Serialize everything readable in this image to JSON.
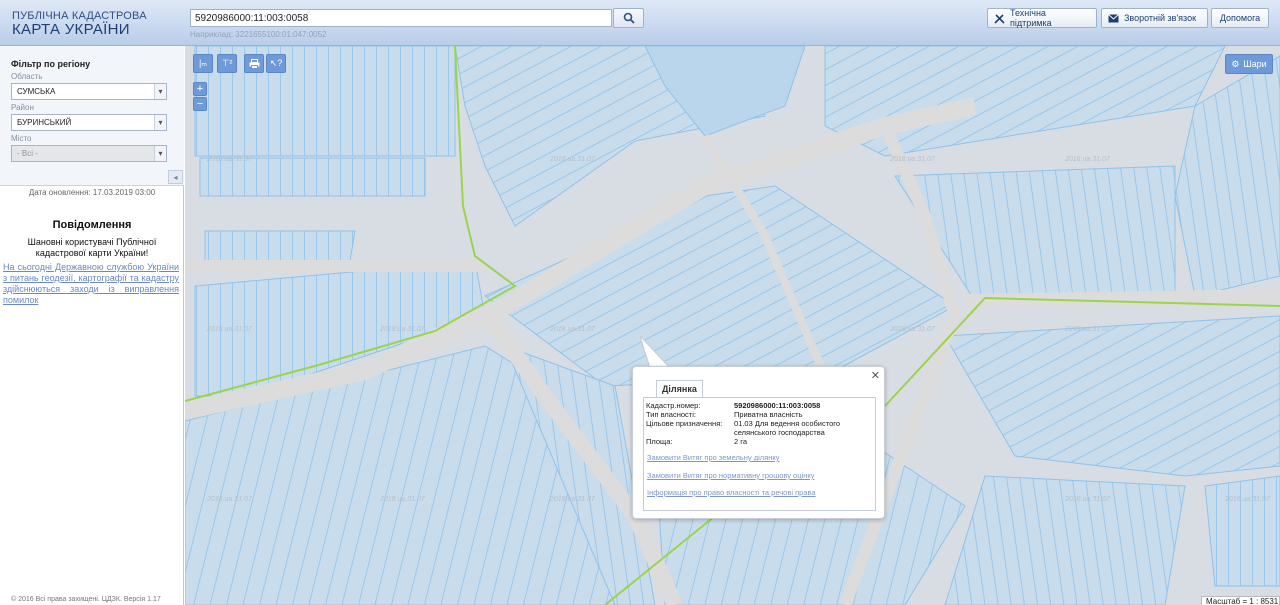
{
  "header": {
    "logo_top": "ПУБЛІЧНА КАДАСТРОВА",
    "logo_main": "КАРТА УКРАЇНИ",
    "search_value": "5920986000:11:003:0058",
    "search_hint": "Наприклад: 3221655100:01:047:0052",
    "buttons": {
      "support": "Технічна підтримка",
      "feedback": "Зворотній зв'язок",
      "help": "Допомога"
    }
  },
  "sidebar": {
    "filter_title": "Фільтр по регіону",
    "region_label": "Область",
    "region_value": "СУМСЬКА",
    "district_label": "Район",
    "district_value": "БУРИНСЬКИЙ",
    "city_label": "Місто",
    "city_value": "- Всі -",
    "update_date": "Дата оновлення: 17.03.2019 03:00",
    "notice_title": "Повідомлення",
    "notice_greeting": "Шановні користувачі Публічної кадастрової карти України!",
    "notice_body": "На сьогодні Державною службою України з питань геодезії, картографії та кадастру здійснюються заходи із виправлення помилок",
    "copyright": "© 2016 Всі права захищені. ЦДЗК. Версія 1.17"
  },
  "map": {
    "layers_label": "Шари",
    "scale_text": "Масштаб = 1 : 8531",
    "watermark": "2018.ua.31.07",
    "tools": {
      "zoom_in": "+",
      "zoom_out": "−"
    }
  },
  "popup": {
    "tab_label": "Ділянка",
    "fields": [
      {
        "key": "Кадастр.номер:",
        "value": "5920986000:11:003:0058"
      },
      {
        "key": "Тип власності:",
        "value": "Приватна власність"
      },
      {
        "key": "Цільове призначення:",
        "value": "01.03 Для ведення особистого селянського господарства"
      },
      {
        "key": "Площа:",
        "value": "2 га"
      }
    ],
    "links": [
      "Замовити Витяг про земельну ділянку",
      "Замовити Витяг про нормативну грошову оцінку",
      "Інформація про право власності та речові права"
    ]
  },
  "colors": {
    "parcel_fill": "#c9dceb",
    "parcel_line": "#8ec2ea",
    "road": "#dcdcdc",
    "boundary": "#9bd44a",
    "accent": "#6f9ad8"
  }
}
